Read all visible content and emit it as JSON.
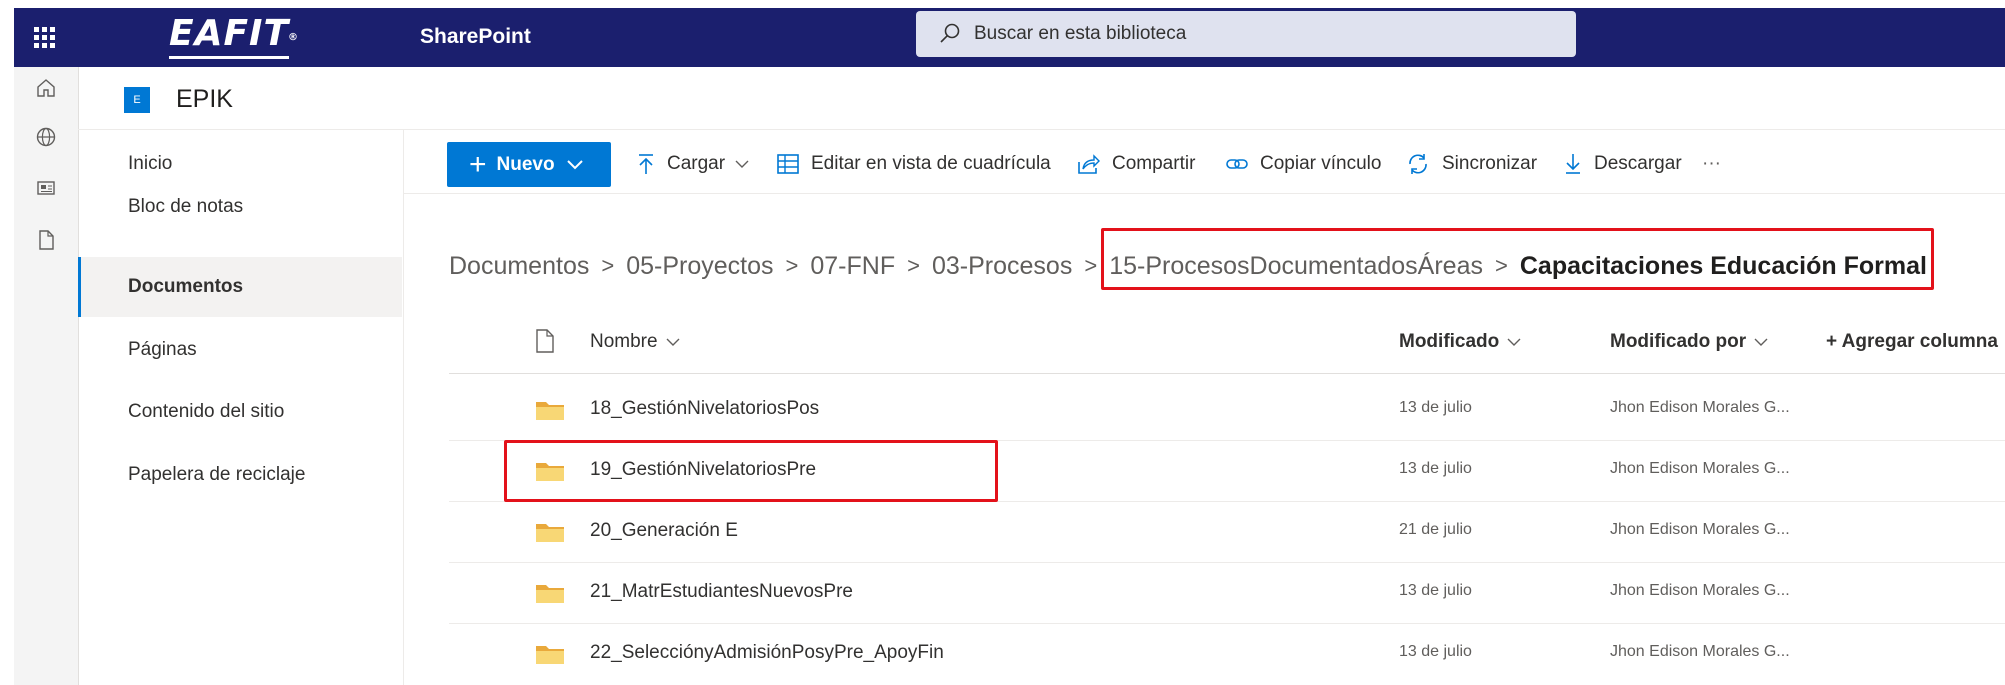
{
  "header": {
    "brand": "EAFIT",
    "brand_mark": "®",
    "app_name": "SharePoint",
    "search_placeholder": "Buscar en esta biblioteca"
  },
  "site": {
    "logo_letter": "E",
    "title": "EPIK"
  },
  "nav": {
    "items": [
      {
        "label": "Inicio"
      },
      {
        "label": "Bloc de notas"
      },
      {
        "label": "Documentos",
        "active": true
      },
      {
        "label": "Páginas"
      },
      {
        "label": "Contenido del sitio"
      },
      {
        "label": "Papelera de reciclaje"
      }
    ]
  },
  "commandbar": {
    "new_label": "Nuevo",
    "upload_label": "Cargar",
    "grid_edit_label": "Editar en vista de cuadrícula",
    "share_label": "Compartir",
    "copy_link_label": "Copiar vínculo",
    "sync_label": "Sincronizar",
    "download_label": "Descargar",
    "more_label": "···"
  },
  "breadcrumb": {
    "items": [
      "Documentos",
      "05-Proyectos",
      "07-FNF",
      "03-Procesos",
      "15-ProcesosDocumentadosÁreas"
    ],
    "current": "Capacitaciones Educación Formal"
  },
  "list": {
    "columns": {
      "name": "Nombre",
      "modified": "Modificado",
      "modified_by": "Modificado por",
      "add_column": "+ Agregar columna"
    },
    "rows": [
      {
        "name": "18_GestiónNivelatoriosPos",
        "modified": "13 de julio",
        "modified_by": "Jhon Edison Morales G..."
      },
      {
        "name": "19_GestiónNivelatoriosPre",
        "modified": "13 de julio",
        "modified_by": "Jhon Edison Morales G..."
      },
      {
        "name": "20_Generación E",
        "modified": "21 de julio",
        "modified_by": "Jhon Edison Morales G..."
      },
      {
        "name": "21_MatrEstudiantesNuevosPre",
        "modified": "13 de julio",
        "modified_by": "Jhon Edison Morales G..."
      },
      {
        "name": "22_SelecciónyAdmisiónPosyPre_ApoyFin",
        "modified": "13 de julio",
        "modified_by": "Jhon Edison Morales G..."
      }
    ]
  },
  "colors": {
    "suite_bar": "#1b1f6e",
    "accent": "#0078d4",
    "highlight": "#e3111a",
    "folder": "#f8d775"
  },
  "icons": [
    "waffle-icon",
    "search-icon",
    "home-icon",
    "globe-icon",
    "news-icon",
    "document-icon",
    "upload-icon",
    "grid-icon",
    "share-icon",
    "link-icon",
    "sync-icon",
    "download-icon",
    "file-type-icon",
    "folder-icon",
    "chevron-down-icon"
  ]
}
